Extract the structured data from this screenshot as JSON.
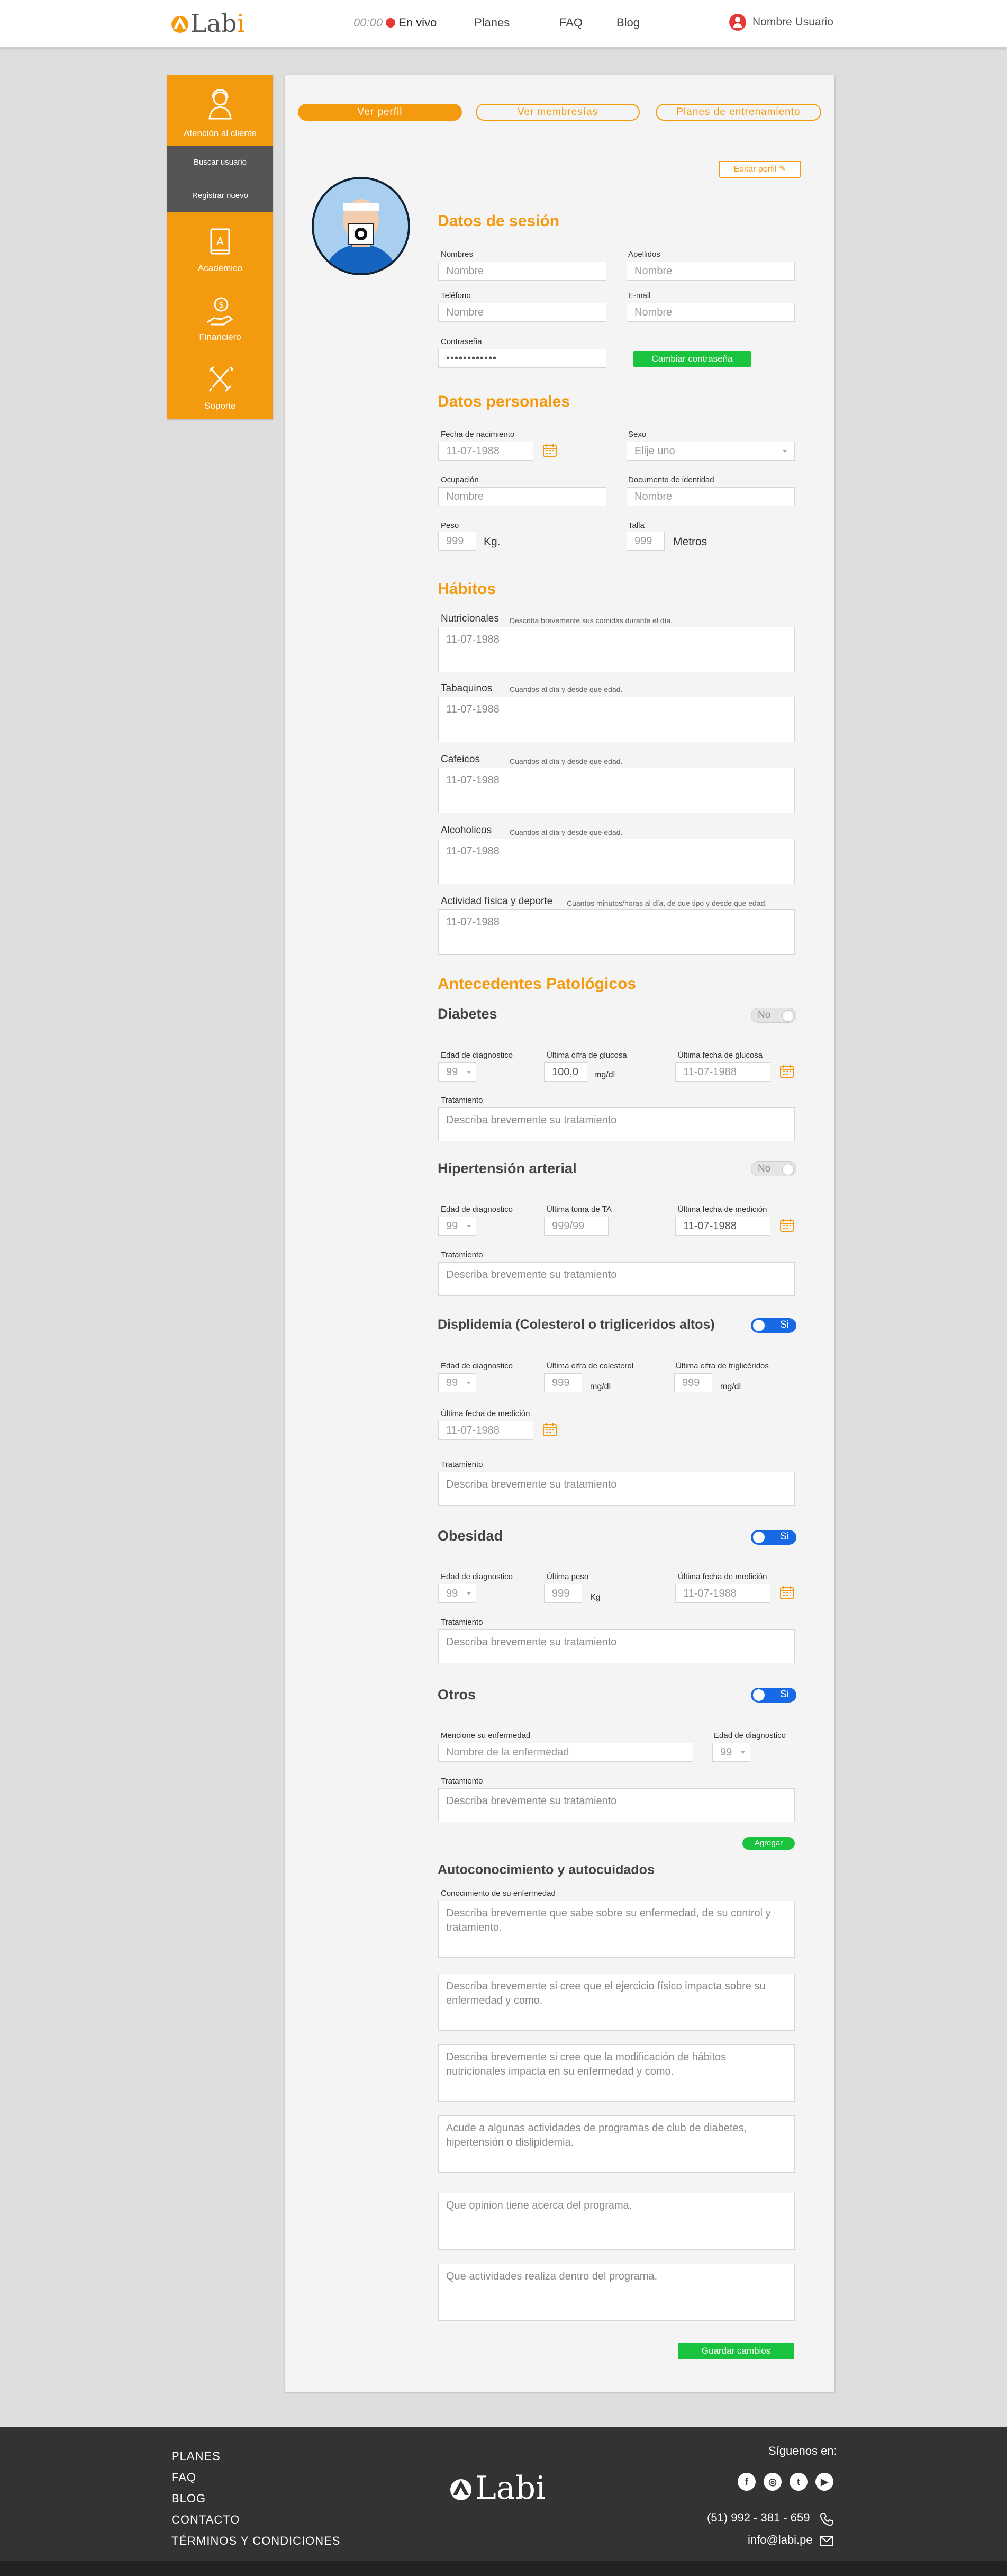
{
  "header": {
    "logo_text": "Lab",
    "logo_text_accent": "i",
    "live_time": "00:00",
    "live_label": "En vivo",
    "nav": [
      "Planes",
      "FAQ",
      "Blog"
    ],
    "user_name": "Nombre Usuario"
  },
  "sidebar": {
    "items": [
      {
        "label": "Atención al cliente",
        "icon": "customer-service-icon"
      },
      {
        "label": "Académico",
        "icon": "book-icon"
      },
      {
        "label": "Financiero",
        "icon": "money-hand-icon"
      },
      {
        "label": "Soporte",
        "icon": "tools-icon"
      }
    ],
    "submenu": [
      "Buscar usuario",
      "Registrar nuevo"
    ]
  },
  "tabs": [
    "Ver perfil",
    "Ver membresías",
    "Planes de entrenamiento"
  ],
  "edit_profile": "Editar perfil",
  "session": {
    "title": "Datos de sesión",
    "nombres_label": "Nombres",
    "nombres_ph": "Nombre",
    "apellidos_label": "Apellidos",
    "apellidos_ph": "Nombre",
    "telefono_label": "Teléfono",
    "telefono_ph": "Nombre",
    "email_label": "E-mail",
    "email_ph": "Nombre",
    "password_label": "Contraseña",
    "password_value": "••••••••••••",
    "change_password": "Cambiar contraseña"
  },
  "personal": {
    "title": "Datos personales",
    "birth_label": "Fecha de nacimiento",
    "birth_value": "11-07-1988",
    "sex_label": "Sexo",
    "sex_value": "Elije uno",
    "occupation_label": "Ocupación",
    "occupation_ph": "Nombre",
    "id_label": "Documento de identidad",
    "id_ph": "Nombre",
    "weight_label": "Peso",
    "weight_value": "999",
    "weight_unit": "Kg.",
    "height_label": "Talla",
    "height_value": "999",
    "height_unit": "Metros"
  },
  "habits": {
    "title": "Hábitos",
    "items": [
      {
        "label": "Nutricionales",
        "hint": "Describa brevemente sus comidas durante el día.",
        "value": "11-07-1988"
      },
      {
        "label": "Tabaquinos",
        "hint": "Cuandos al día y desde que edad.",
        "value": "11-07-1988"
      },
      {
        "label": "Cafeicos",
        "hint": "Cuandos al día y desde que edad.",
        "value": "11-07-1988"
      },
      {
        "label": "Alcoholicos",
        "hint": "Cuandos al día y desde que edad.",
        "value": "11-07-1988"
      },
      {
        "label": "Actividad física y deporte",
        "hint": "Cuantos minutos/horas al día, de que tipo y desde que edad.",
        "value": "11-07-1988"
      }
    ]
  },
  "antecedentes": {
    "title": "Antecedentes Patológicos",
    "treatment_label": "Tratamiento",
    "treatment_ph": "Describa brevemente su tratamiento",
    "age_label": "Edad de diagnostico",
    "age_value": "99",
    "date_value": "11-07-1988",
    "diabetes": {
      "title": "Diabetes",
      "toggle": "No",
      "glucose_label": "Última cifra de glucosa",
      "glucose_value": "100,0",
      "glucose_unit": "mg/dl",
      "glucose_date_label": "Última fecha de glucosa"
    },
    "hipertension": {
      "title": "Hipertensión arterial",
      "toggle": "No",
      "ta_label": "Última toma de TA",
      "ta_ph": "999/99",
      "date_label": "Última fecha de medición"
    },
    "dislipidemia": {
      "title": "Displidemia (Colesterol o trigliceridos altos)",
      "toggle": "Si",
      "chol_label": "Última cifra de colesterol",
      "chol_value": "999",
      "chol_unit": "mg/dl",
      "trig_label": "Última cifra de triglicéridos",
      "trig_value": "999",
      "trig_unit": "mg/dl",
      "date_label": "Última fecha de medición"
    },
    "obesidad": {
      "title": "Obesidad",
      "toggle": "Si",
      "weight_label": "Última peso",
      "weight_value": "999",
      "weight_unit": "Kg",
      "date_label": "Última fecha de medición"
    },
    "otros": {
      "title": "Otros",
      "toggle": "Si",
      "disease_label": "Mencione su enfermedad",
      "disease_ph": "Nombre de la enfermedad"
    },
    "add_button": "Agregar"
  },
  "autoconocimiento": {
    "title": "Autoconocimiento y autocuidados",
    "label": "Conocimiento de su enfermedad",
    "fields": [
      "Describa brevemente que sabe sobre su enfermedad, de su control y tratamiento.",
      "Describa brevemente si cree que el ejercicio físico impacta sobre su enfermedad y como.",
      "Describa brevemente si cree que la modificación de hábitos nutricionales impacta en su enfermedad y como.",
      "Acude a algunas actividades de programas de club de diabetes, hipertensión o dislipidemia.",
      "Que opinion tiene acerca del programa.",
      "Que actividades realiza dentro del programa."
    ],
    "save": "Guardar cambios"
  },
  "footer": {
    "links": [
      "PLANES",
      "FAQ",
      "BLOG",
      "CONTACTO",
      "TÉRMINOS Y CONDICIONES"
    ],
    "logo_text": "Labi",
    "follow": "Síguenos en:",
    "phone": "(51) 992 - 381 - 659",
    "email": "info@labi.pe",
    "social_icons": [
      "facebook-icon",
      "instagram-icon",
      "twitter-icon",
      "youtube-icon"
    ]
  },
  "colors": {
    "accent": "#f49a0e",
    "green": "#19c33d",
    "toggle_on": "#1769e5",
    "sidebar_sub": "#555555",
    "footer": "#333333"
  }
}
